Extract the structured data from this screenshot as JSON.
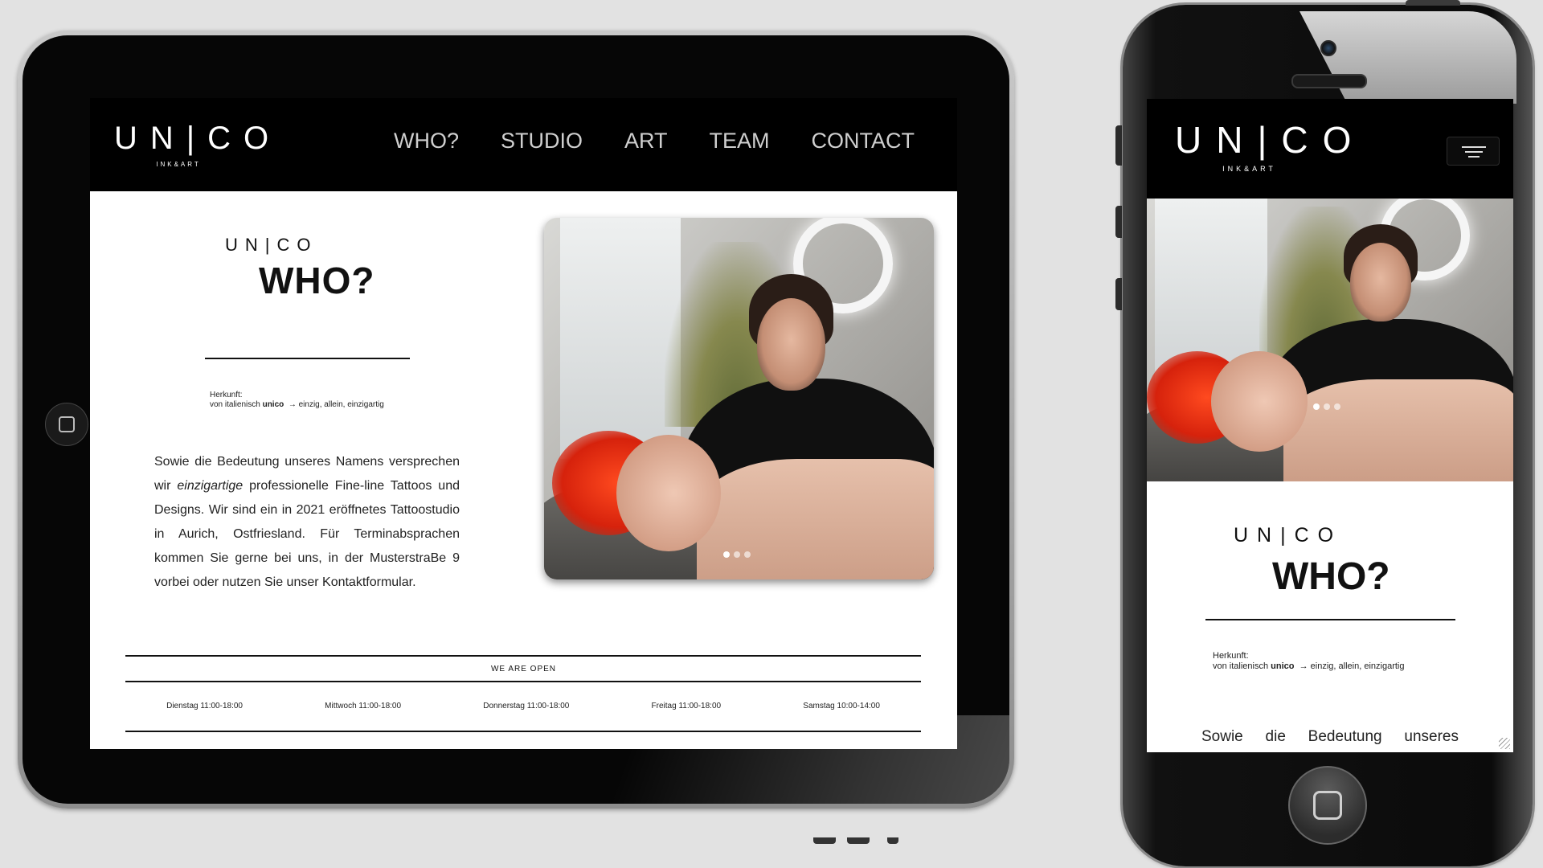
{
  "brand": {
    "word": "UN|CO",
    "sub": "INK&ART",
    "mini": "UN|CO"
  },
  "nav": [
    "WHO?",
    "STUDIO",
    "ART",
    "TEAM",
    "CONTACT"
  ],
  "who": {
    "title": "WHO?",
    "origin_label": "Herkunft:",
    "origin_prefix": "von italienisch",
    "origin_word": "unico",
    "origin_meaning": "→ einzig, allein, einzigartig",
    "para_before": "Sowie die Bedeutung unseres Namens versprechen wir ",
    "para_em": "einzigartige",
    "para_after": " professionelle Fine-line Tattoos und Designs. Wir sind ein in 2021 eröffnetes Tattoostudio in Aurich, Ostfriesland. Für Terminabsprachen kommen Sie gerne bei uns, in der MusterstraBe 9 vorbei oder nutzen Sie unser Kontaktformular."
  },
  "hours": {
    "label": "WE ARE OPEN",
    "days": [
      "Dienstag 11:00-18:00",
      "Mittwoch 11:00-18:00",
      "Donnerstag 11:00-18:00",
      "Freitag 11:00-18:00",
      "Samstag 10:00-14:00"
    ]
  },
  "phone": {
    "para_words": [
      "Sowie",
      "die",
      "Bedeutung",
      "unseres"
    ]
  },
  "carousel": {
    "slides": 3,
    "active": 1
  },
  "colors": {
    "header": "#000000",
    "page": "#ffffff",
    "text": "#111111",
    "backdrop": "#e2e2e2",
    "accent_hair": "#e0300f"
  },
  "icons": {
    "tablet_home": "home-button-icon",
    "phone_home": "home-button-icon",
    "menu": "hamburger-menu-icon"
  }
}
